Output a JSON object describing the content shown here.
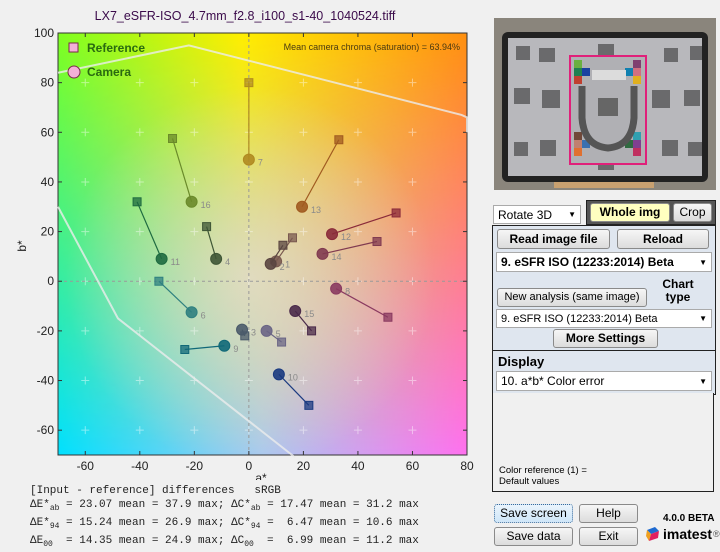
{
  "window": {
    "plot_title": "LX7_eSFR-ISO_4.7mm_f2.8_i100_s1-40_1040524.tiff"
  },
  "chart_data": {
    "type": "scatter",
    "title": "LX7_eSFR-ISO_4.7mm_f2.8_i100_s1-40_1040524.tiff",
    "xlabel": "a*",
    "ylabel": "b*",
    "xlim": [
      -70,
      80
    ],
    "ylim": [
      -70,
      100
    ],
    "xticks": [
      -60,
      -40,
      -20,
      0,
      20,
      40,
      60,
      80
    ],
    "yticks": [
      -60,
      -40,
      -20,
      0,
      20,
      40,
      60,
      80,
      100
    ],
    "annotation": "Mean camera chroma (saturation) = 63.94%",
    "legend": {
      "position": "top-left",
      "entries": [
        "Reference",
        "Camera"
      ]
    },
    "grid": "crosshair-marks",
    "gamut_boundary_name": "sRGB",
    "gamut_boundary": [
      [
        -70,
        84
      ],
      [
        -22,
        95
      ],
      [
        78,
        67
      ],
      [
        80,
        66
      ],
      [
        80,
        60
      ]
    ],
    "gamut_boundary_lower": [
      [
        -70,
        30
      ],
      [
        -48,
        -15
      ],
      [
        17,
        -71
      ]
    ],
    "patches": [
      {
        "id": "1",
        "ref": [
          16,
          17.5
        ],
        "cam": [
          10,
          8
        ],
        "color": "#7a5a50"
      },
      {
        "id": "2",
        "ref": [
          12.5,
          14.5
        ],
        "cam": [
          8,
          7
        ],
        "color": "#5a4540"
      },
      {
        "id": "3",
        "ref": [
          -1.5,
          -22
        ],
        "cam": [
          -2.5,
          -19.5
        ],
        "color": "#4a5a6a"
      },
      {
        "id": "4",
        "ref": [
          -15.5,
          22
        ],
        "cam": [
          -12,
          9
        ],
        "color": "#3e5535"
      },
      {
        "id": "5",
        "ref": [
          12,
          -24.5
        ],
        "cam": [
          6.5,
          -20
        ],
        "color": "#6a6585"
      },
      {
        "id": "6",
        "ref": [
          -33,
          0
        ],
        "cam": [
          -21,
          -12.5
        ],
        "color": "#2f8080"
      },
      {
        "id": "7",
        "ref": [
          0,
          80
        ],
        "cam": [
          0,
          49
        ],
        "color": "#b08a20"
      },
      {
        "id": "8",
        "ref": [
          51,
          -14.5
        ],
        "cam": [
          32,
          -3
        ],
        "color": "#8a3a60"
      },
      {
        "id": "9",
        "ref": [
          -23.5,
          -27.5
        ],
        "cam": [
          -9,
          -26
        ],
        "color": "#106878"
      },
      {
        "id": "10",
        "ref": [
          22,
          -50
        ],
        "cam": [
          11,
          -37.5
        ],
        "color": "#1a3a80"
      },
      {
        "id": "11",
        "ref": [
          -41,
          32
        ],
        "cam": [
          -32,
          9
        ],
        "color": "#1e6a40"
      },
      {
        "id": "12",
        "ref": [
          54,
          27.5
        ],
        "cam": [
          30.5,
          19
        ],
        "color": "#8a2a3a"
      },
      {
        "id": "13",
        "ref": [
          33,
          57
        ],
        "cam": [
          19.5,
          30
        ],
        "color": "#a05a20"
      },
      {
        "id": "14",
        "ref": [
          47,
          16
        ],
        "cam": [
          27,
          11
        ],
        "color": "#803a50"
      },
      {
        "id": "15",
        "ref": [
          23,
          -20
        ],
        "cam": [
          17,
          -12
        ],
        "color": "#4a2a4a"
      },
      {
        "id": "16",
        "ref": [
          -28,
          57.5
        ],
        "cam": [
          -21,
          32
        ],
        "color": "#6a8a2a"
      }
    ]
  },
  "stats": {
    "header": "[Input - reference] differences   sRGB",
    "lines": [
      {
        "left_sym": "ΔE*",
        "left_sub": "ab",
        "left_val": " = 23.07 mean = 37.9 max; ",
        "right_sym": "ΔC*",
        "right_sub": "ab",
        "right_val": " = 17.47 mean = 31.2 max"
      },
      {
        "left_sym": "ΔE*",
        "left_sub": "94",
        "left_val": " = 15.24 mean = 26.9 max; ",
        "right_sym": "ΔC*",
        "right_sub": "94",
        "right_val": " =  6.47 mean = 10.6 max"
      },
      {
        "left_sym": "ΔE",
        "left_sub": "00",
        "left_val": "  = 14.35 mean = 24.9 max; ",
        "right_sym": "ΔC",
        "right_sub": "00",
        "right_val": "  =  6.99 mean = 11.2 max"
      }
    ]
  },
  "controls": {
    "rotate_select": "Rotate 3D",
    "whole_img": "Whole img",
    "crop": "Crop",
    "read_image_file": "Read image file",
    "reload": "Reload",
    "chart_select_top": "9. eSFR ISO  (12233:2014)  Beta",
    "new_analysis": "New analysis (same image)",
    "chart_type_label_1": "Chart",
    "chart_type_label_2": "type",
    "chart_select_bottom": "9. eSFR ISO  (12233:2014)  Beta",
    "more_settings": "More Settings",
    "display_label": "Display",
    "display_select": "10. a*b* Color error",
    "color_ref_line1": "Color reference (1) =",
    "color_ref_line2": "Default values",
    "save_screen": "Save screen",
    "help": "Help",
    "save_data": "Save data",
    "exit": "Exit",
    "version": "4.0.0 BETA",
    "brand": "imatest",
    "registered": "®"
  }
}
